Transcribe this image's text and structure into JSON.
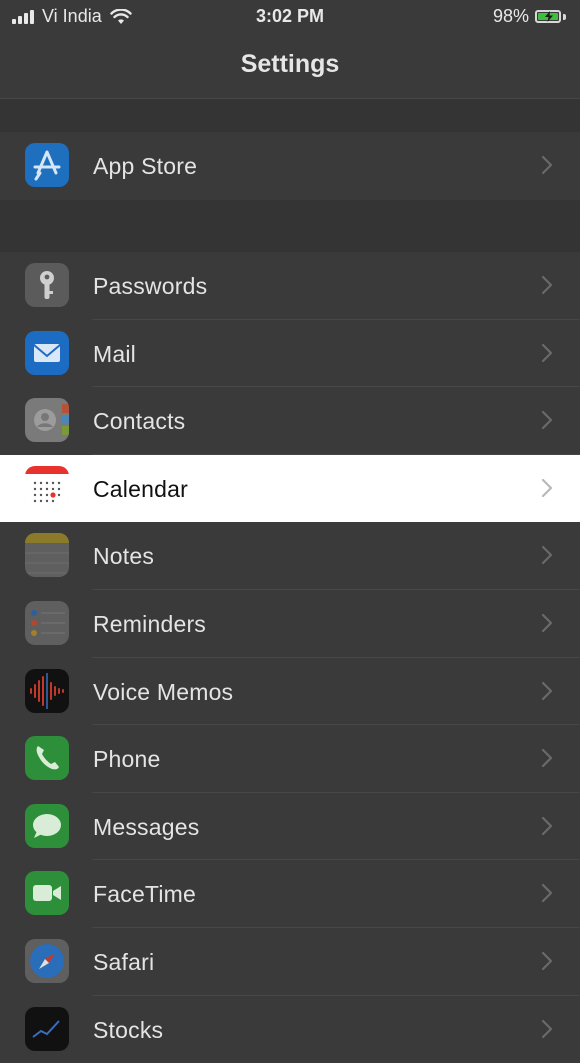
{
  "status_bar": {
    "carrier": "Vi India",
    "time": "3:02 PM",
    "battery_percent": "98%",
    "battery_level": 0.98
  },
  "nav": {
    "title": "Settings"
  },
  "groups": [
    {
      "items": [
        {
          "label": "App Store",
          "icon": "app-store-icon"
        }
      ]
    },
    {
      "items": [
        {
          "label": "Passwords",
          "icon": "key-icon"
        },
        {
          "label": "Mail",
          "icon": "mail-icon"
        },
        {
          "label": "Contacts",
          "icon": "contacts-icon"
        },
        {
          "label": "Calendar",
          "icon": "calendar-icon",
          "highlighted": true
        },
        {
          "label": "Notes",
          "icon": "notes-icon"
        },
        {
          "label": "Reminders",
          "icon": "reminders-icon"
        },
        {
          "label": "Voice Memos",
          "icon": "voice-memos-icon"
        },
        {
          "label": "Phone",
          "icon": "phone-icon"
        },
        {
          "label": "Messages",
          "icon": "messages-icon"
        },
        {
          "label": "FaceTime",
          "icon": "facetime-icon"
        },
        {
          "label": "Safari",
          "icon": "safari-icon"
        },
        {
          "label": "Stocks",
          "icon": "stocks-icon"
        }
      ]
    }
  ],
  "colors": {
    "dim_background": "#3a3a3a",
    "highlight_row": "#ffffff",
    "app_store_blue": "#1f6fbf",
    "phone_green": "#2e8f3a",
    "calendar_red": "#e8322d"
  }
}
